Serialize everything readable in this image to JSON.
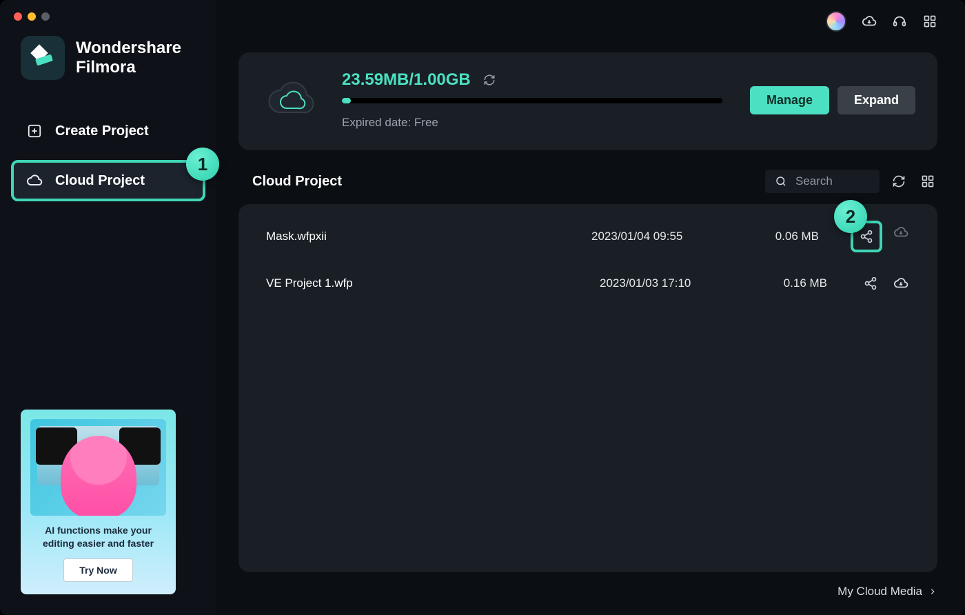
{
  "brand": {
    "line1": "Wondershare",
    "line2": "Filmora"
  },
  "sidebar": {
    "items": [
      {
        "label": "Create Project"
      },
      {
        "label": "Cloud Project"
      }
    ]
  },
  "promo": {
    "text": "AI functions make your editing easier and faster",
    "cta": "Try Now"
  },
  "storage": {
    "usage_text": "23.59MB/1.00GB",
    "expired_label": "Expired date: Free",
    "manage_label": "Manage",
    "expand_label": "Expand",
    "fill_percent": 2.3
  },
  "section": {
    "title": "Cloud Project",
    "search_placeholder": "Search"
  },
  "files": [
    {
      "name": "Mask.wfpxii",
      "date": "2023/01/04 09:55",
      "size": "0.06 MB"
    },
    {
      "name": "VE Project 1.wfp",
      "date": "2023/01/03 17:10",
      "size": "0.16 MB"
    }
  ],
  "footer": {
    "my_cloud_media": "My Cloud Media"
  },
  "callouts": {
    "one": "1",
    "two": "2"
  },
  "colors": {
    "accent": "#4be0c1"
  }
}
